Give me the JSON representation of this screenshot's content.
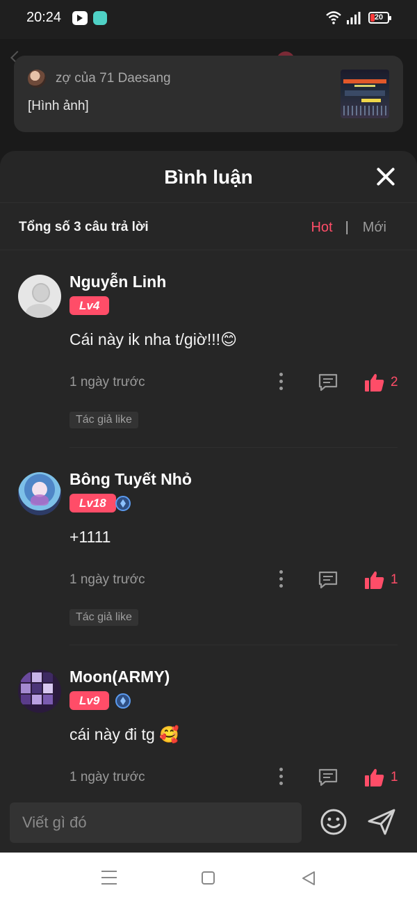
{
  "status_bar": {
    "time": "20:24",
    "battery_level": "20"
  },
  "post": {
    "author": "zợ của 71 Daesang",
    "content": "[Hình ảnh]"
  },
  "sheet": {
    "title": "Bình luận",
    "total_label": "Tổng số 3 câu trả lời",
    "sort_hot": "Hot",
    "sort_separator": "|",
    "sort_new": "Mới"
  },
  "comments": [
    {
      "name": "Nguyễn Linh",
      "level": "Lv4",
      "text": "Cái này ik nha t/giờ!!!😊",
      "time": "1 ngày trước",
      "likes": "2",
      "tag": "Tác giả like"
    },
    {
      "name": "Bông Tuyết Nhỏ",
      "level": "Lv18",
      "text": "+1111",
      "time": "1 ngày trước",
      "likes": "1",
      "tag": "Tác giả like"
    },
    {
      "name": "Moon(ARMY)",
      "level": "Lv9",
      "text": "cái này đi tg 🥰",
      "time": "1 ngày trước",
      "likes": "1"
    }
  ],
  "input": {
    "placeholder": "Viết gì đó"
  },
  "colors": {
    "accent": "#ff4d68",
    "sheet_bg": "#262626",
    "muted_text": "#9a9a9a"
  }
}
